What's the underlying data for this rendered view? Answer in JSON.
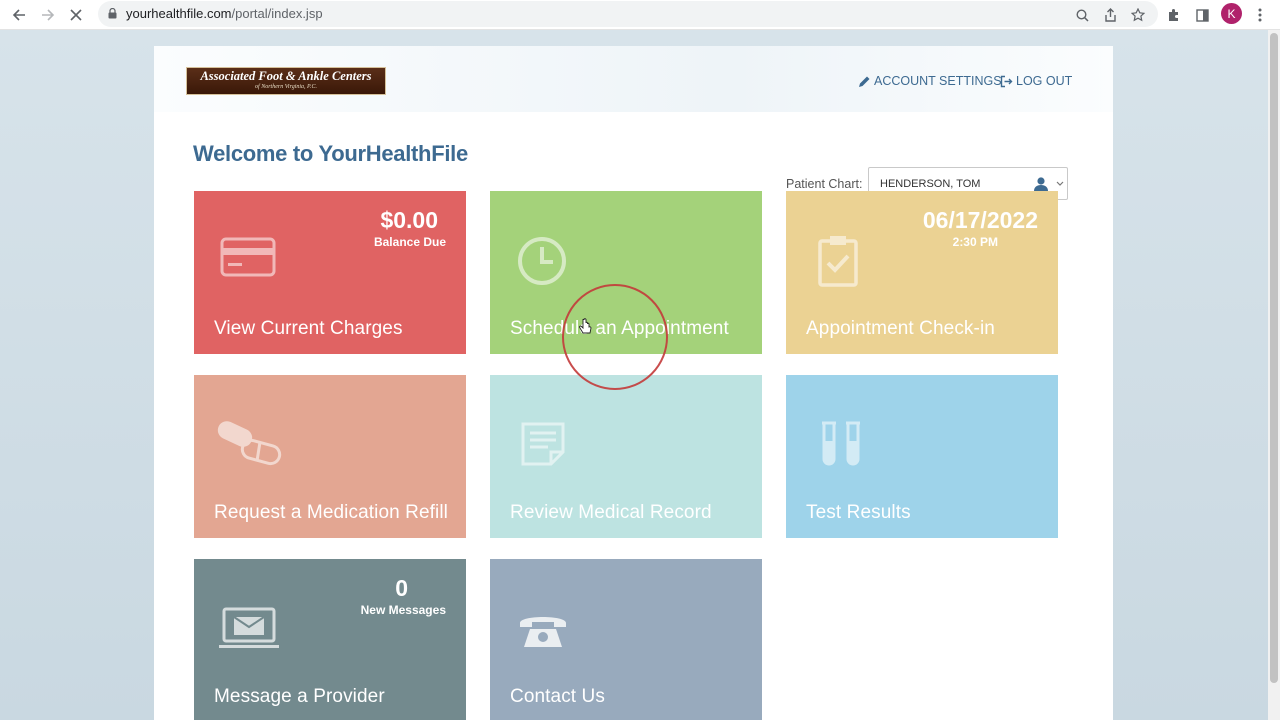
{
  "browser": {
    "url_host": "yourhealthfile.com",
    "url_path": "/portal/index.jsp",
    "profile_initial": "K"
  },
  "header": {
    "logo_main": "Associated Foot & Ankle Centers",
    "logo_sub": "of Northern Virginia, P.C.",
    "account_settings": "ACCOUNT SETTINGS",
    "log_out": "LOG OUT"
  },
  "welcome_title": "Welcome to YourHealthFile",
  "patient_chart": {
    "label": "Patient Chart:",
    "value": "HENDERSON, TOM"
  },
  "tiles": [
    {
      "label": "View Current Charges",
      "big": "$0.00",
      "small": "Balance Due",
      "icon": "credit-card-icon",
      "color": "#e06363"
    },
    {
      "label": "Schedule an Appointment",
      "big": "",
      "small": "",
      "icon": "clock-icon",
      "color": "#a4d27a"
    },
    {
      "label": "Appointment Check-in",
      "big": "06/17/2022",
      "small": "2:30 PM",
      "icon": "clipboard-check-icon",
      "color": "#ebd293"
    },
    {
      "label": "Request a Medication Refill",
      "big": "",
      "small": "",
      "icon": "pills-icon",
      "color": "#e3a692"
    },
    {
      "label": "Review Medical Record",
      "big": "",
      "small": "",
      "icon": "document-icon",
      "color": "#bde3e1"
    },
    {
      "label": "Test Results",
      "big": "",
      "small": "",
      "icon": "test-tubes-icon",
      "color": "#9ed3ea"
    },
    {
      "label": "Message a Provider",
      "big": "0",
      "small": "New Messages",
      "icon": "laptop-mail-icon",
      "color": "#738a8e"
    },
    {
      "label": "Contact Us",
      "big": "",
      "small": "",
      "icon": "telephone-icon",
      "color": "#98aabd"
    }
  ]
}
